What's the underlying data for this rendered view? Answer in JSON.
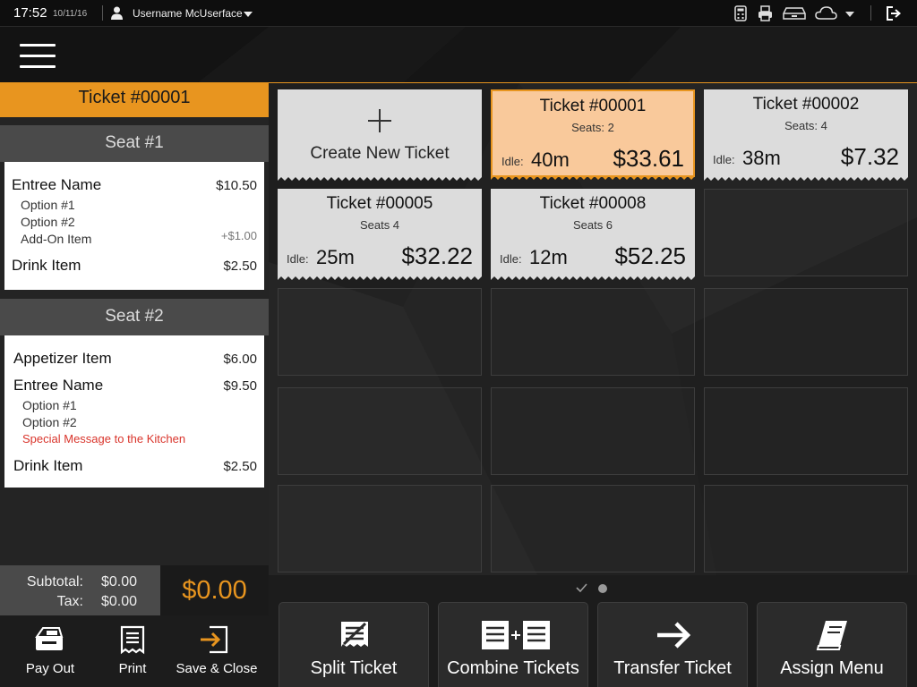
{
  "topbar": {
    "time": "17:52",
    "date": "10/11/16",
    "username": "Username McUserface",
    "icons": [
      "calculator-icon",
      "printer-icon",
      "cash-drawer-icon",
      "cloud-icon",
      "dropdown-caret-icon",
      "logout-icon"
    ]
  },
  "order": {
    "ticket_title": "Ticket #00001",
    "seats": [
      {
        "label": "Seat #1",
        "items": [
          {
            "name": "Entree Name",
            "price": "$10.50",
            "options": [
              "Option #1",
              "Option #2"
            ],
            "addon": {
              "name": "Add-On Item",
              "price": "+$1.00"
            }
          },
          {
            "name": "Drink Item",
            "price": "$2.50"
          }
        ]
      },
      {
        "label": "Seat #2",
        "items": [
          {
            "name": "Appetizer Item",
            "price": "$6.00"
          },
          {
            "name": "Entree Name",
            "price": "$9.50",
            "options": [
              "Option #1",
              "Option #2"
            ],
            "kitchen_message": "Special Message to the Kitchen"
          },
          {
            "name": "Drink Item",
            "price": "$2.50"
          }
        ]
      }
    ],
    "subtotal_label": "Subtotal:",
    "subtotal": "$0.00",
    "tax_label": "Tax:",
    "tax": "$0.00",
    "total": "$0.00"
  },
  "left_actions": [
    {
      "label": "Pay Out",
      "icon": "cash-register-icon"
    },
    {
      "label": "Print",
      "icon": "receipt-icon"
    },
    {
      "label": "Save & Close",
      "icon": "save-close-icon"
    }
  ],
  "tickets": {
    "create_label": "Create New Ticket",
    "idle_label": "Idle:",
    "items": [
      {
        "title": "Ticket #00001",
        "seats": "Seats: 2",
        "idle": "40m",
        "amount": "$33.61",
        "active": true
      },
      {
        "title": "Ticket #00002",
        "seats": "Seats: 4",
        "idle": "38m",
        "amount": "$7.32",
        "active": false
      },
      {
        "title": "Ticket #00005",
        "seats": "Seats 4",
        "idle": "25m",
        "amount": "$32.22",
        "active": false
      },
      {
        "title": "Ticket #00008",
        "seats": "Seats 6",
        "idle": "12m",
        "amount": "$52.25",
        "active": false
      }
    ]
  },
  "pager": {
    "pages": 2,
    "current": 1
  },
  "bottom_actions": [
    {
      "label": "Split Ticket",
      "icon": "split-ticket-icon"
    },
    {
      "label": "Combine Tickets",
      "icon": "combine-tickets-icon"
    },
    {
      "label": "Transfer Ticket",
      "icon": "arrow-right-icon"
    },
    {
      "label": "Assign Menu",
      "icon": "book-icon"
    }
  ],
  "colors": {
    "accent": "#e8951f",
    "active_card": "#f9c99b",
    "kitchen_text": "#d9342b"
  }
}
